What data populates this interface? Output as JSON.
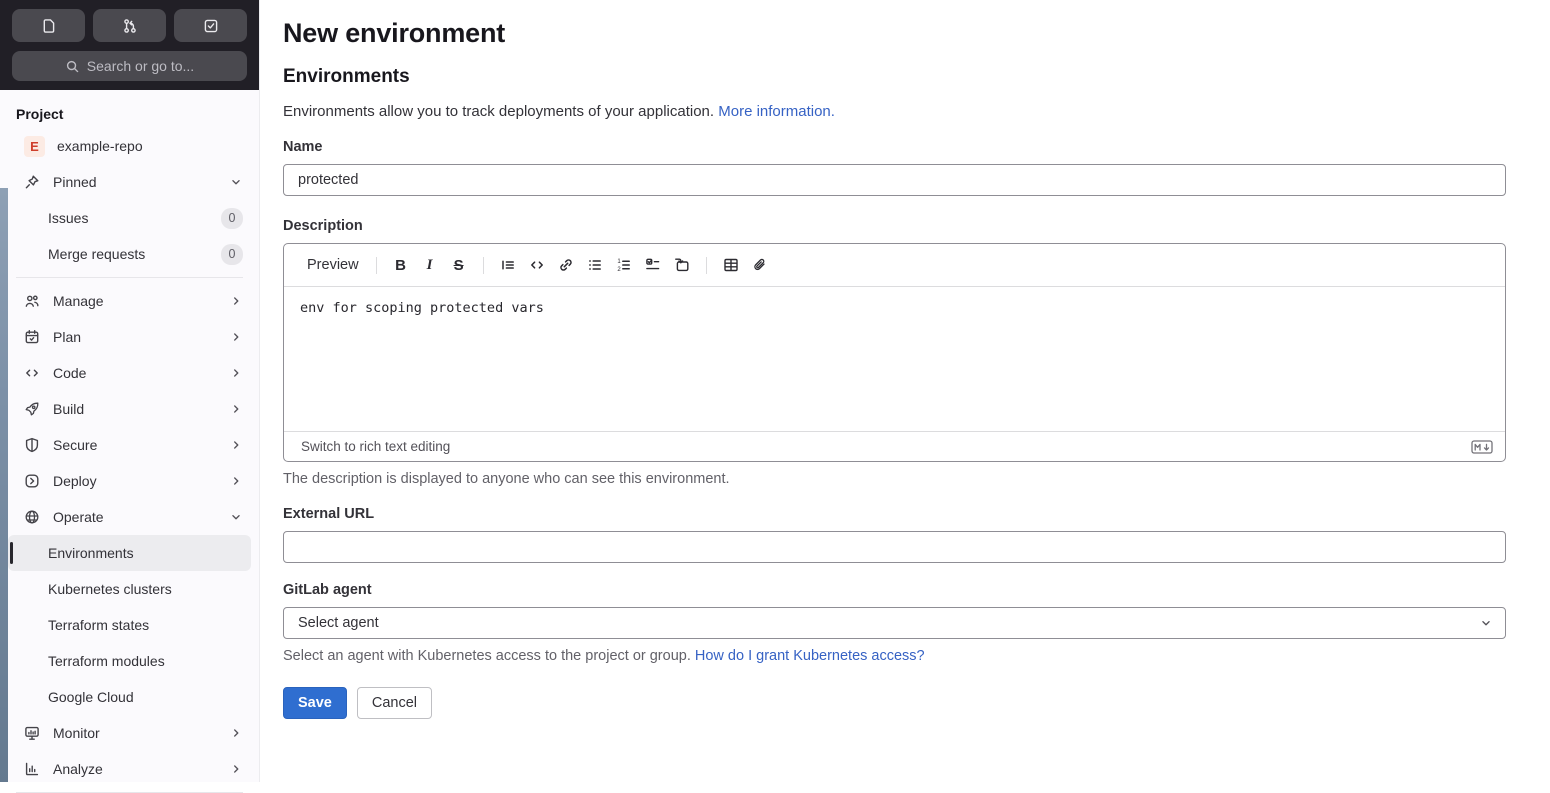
{
  "topbar": {
    "search_placeholder": "Search or go to...",
    "buttons": [
      {
        "icon": "issues-icon"
      },
      {
        "icon": "merge-request-icon"
      },
      {
        "icon": "todo-icon"
      }
    ]
  },
  "sidebar": {
    "section_label": "Project",
    "project": {
      "avatar_letter": "E",
      "name": "example-repo"
    },
    "pinned_label": "Pinned",
    "pinned_items": [
      {
        "label": "Issues",
        "badge": "0"
      },
      {
        "label": "Merge requests",
        "badge": "0"
      }
    ],
    "nav": [
      {
        "label": "Manage",
        "icon": "users-icon"
      },
      {
        "label": "Plan",
        "icon": "calendar-icon"
      },
      {
        "label": "Code",
        "icon": "code-icon"
      },
      {
        "label": "Build",
        "icon": "rocket-icon"
      },
      {
        "label": "Secure",
        "icon": "shield-icon"
      },
      {
        "label": "Deploy",
        "icon": "deploy-icon"
      },
      {
        "label": "Operate",
        "icon": "operate-icon"
      }
    ],
    "operate_children": [
      "Environments",
      "Kubernetes clusters",
      "Terraform states",
      "Terraform modules",
      "Google Cloud"
    ],
    "active_item": "Environments",
    "nav_bottom": [
      {
        "label": "Monitor",
        "icon": "monitor-icon"
      },
      {
        "label": "Analyze",
        "icon": "analyze-icon"
      }
    ]
  },
  "main": {
    "title": "New environment",
    "section_title": "Environments",
    "intro_text": "Environments allow you to track deployments of your application.",
    "intro_link": "More information.",
    "name_field": {
      "label": "Name",
      "value": "protected"
    },
    "description_field": {
      "label": "Description",
      "preview_label": "Preview",
      "toolbar_icons": [
        "bold-icon",
        "italic-icon",
        "strikethrough-icon",
        "quote-icon",
        "code-icon",
        "link-icon",
        "bullet-list-icon",
        "numbered-list-icon",
        "task-list-icon",
        "collapsible-section-icon",
        "table-icon",
        "attachment-icon",
        "markdown-icon"
      ],
      "value": "env for scoping protected vars",
      "footer_link": "Switch to rich text editing",
      "help": "The description is displayed to anyone who can see this environment."
    },
    "external_url_field": {
      "label": "External URL",
      "value": ""
    },
    "agent_field": {
      "label": "GitLab agent",
      "selected": "Select agent",
      "help": "Select an agent with Kubernetes access to the project or group.",
      "help_link": "How do I grant Kubernetes access?"
    },
    "actions": {
      "save": "Save",
      "cancel": "Cancel"
    }
  },
  "colors": {
    "accent_blue": "#2f6ed0",
    "link_blue": "#3662c4",
    "topbar_dark": "#211f26",
    "sidebar_bg": "#fbfafd"
  }
}
